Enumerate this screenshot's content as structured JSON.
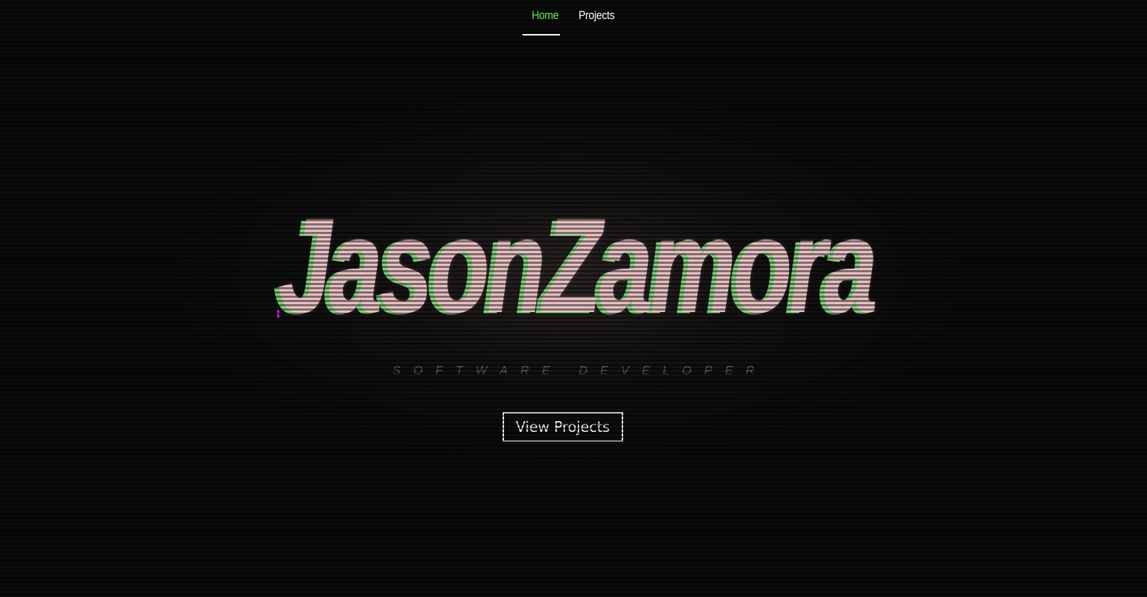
{
  "nav": {
    "items": [
      {
        "label": "Home",
        "active": true
      },
      {
        "label": "Projects",
        "active": false
      }
    ]
  },
  "hero": {
    "name": "JasonZamora",
    "subtitle": "SOFTWARE DEVELOPER",
    "cta_label": "View Projects"
  },
  "colors": {
    "background": "#0b0b0b",
    "nav_active": "#5ff05a",
    "nav_text": "#ffffff",
    "name_front": "#e8c1c3",
    "name_shadow": "#7cd47a",
    "subtitle": "#5e5e5e",
    "button_border": "#ffffff",
    "glitch_accent": "#d020f0"
  }
}
